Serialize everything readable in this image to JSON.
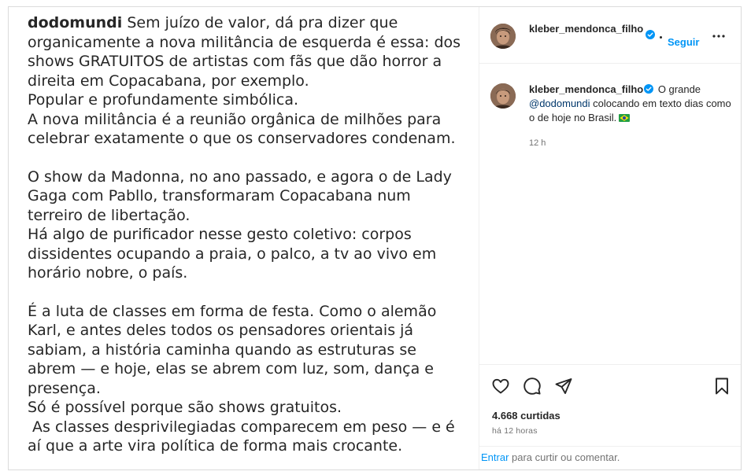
{
  "media": {
    "handle": "dodomundi",
    "paragraphs": [
      " Sem juízo de valor, dá pra dizer que\norganicamente a nova militância de esquerda é essa: dos\nshows GRATUITOS de artistas com fãs que dão horror a\ndireita em Copacabana, por exemplo.",
      "Popular e profundamente simbólica.",
      "A nova militância é a reunião orgânica de milhões para\ncelebrar exatamente o que os conservadores condenam.",
      "O show da Madonna, no ano passado, e agora o de Lady\nGaga com Pabllo, transformaram Copacabana num\nterreiro de libertação.",
      "Há algo de purificador nesse gesto coletivo: corpos\ndissidentes ocupando a praia, o palco, a tv ao vivo em\nhorário nobre, o país.",
      "É a luta de classes em forma de festa. Como o alemão\nKarl, e antes deles todos os pensadores orientais já\nsabiam, a história caminha quando as estruturas se\nabrem — e hoje, elas se abrem com luz, som, dança e\npresença.",
      "Só é possível porque são shows gratuitos.",
      " As classes desprivilegiadas comparecem em peso — e é\naí que a arte vira política de forma mais crocante."
    ]
  },
  "header": {
    "username": "kleber_mendonca_filho",
    "follow_label": "Seguir",
    "more_icon": "more-horizontal-icon",
    "verified_icon": "verified-badge-icon"
  },
  "comment": {
    "author": "kleber_mendonca_filho",
    "text_before": " O grande ",
    "mention": "@dodomundi",
    "text_after": " colocando em texto dias como o de hoje no Brasil.",
    "emoji": "brazil-flag-icon",
    "time": "12 h"
  },
  "actions": {
    "like_icon": "heart-icon",
    "comment_icon": "comment-bubble-icon",
    "share_icon": "paper-plane-icon",
    "save_icon": "bookmark-icon",
    "likes_text": "4.668 curtidas",
    "posted_time": "há 12 horas"
  },
  "login_bar": {
    "link_label": "Entrar",
    "text": " para curtir ou comentar."
  },
  "colors": {
    "accent_blue": "#0095f6",
    "mention_blue": "#00376b",
    "text": "#262626",
    "secondary_text": "#737373",
    "border": "#dbdbdb"
  }
}
